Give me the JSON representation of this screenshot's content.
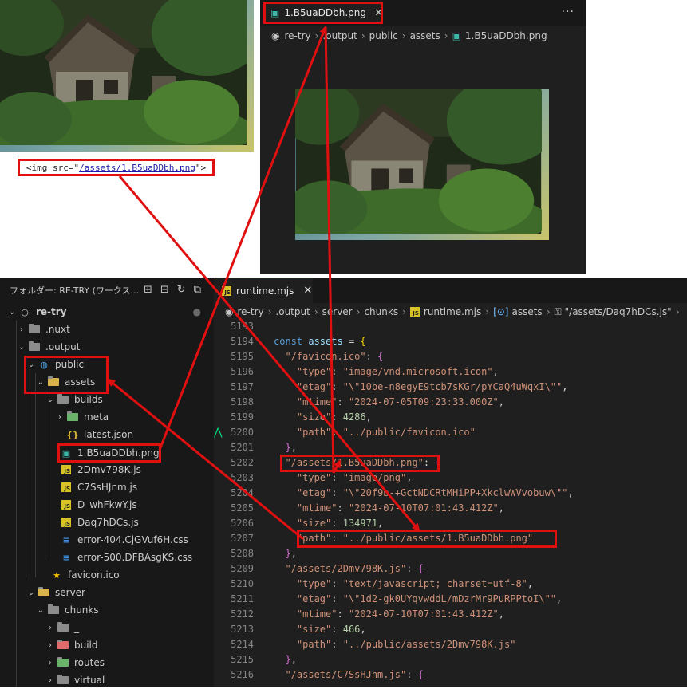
{
  "browser": {
    "img_tag_prefix": "<img src=\"",
    "img_tag_src": "/assets/1.B5uaDDbh.png",
    "img_tag_suffix": "\">"
  },
  "preview": {
    "tab_label": "1.B5uaDDbh.png",
    "more_label": "···",
    "breadcrumbs": [
      "re-try",
      ".output",
      "public",
      "assets",
      "1.B5uaDDbh.png"
    ]
  },
  "explorer": {
    "title": "フォルダー: RE-TRY (ワークス...",
    "items": [
      {
        "label": "re-try"
      },
      {
        "label": ".nuxt"
      },
      {
        "label": ".output"
      },
      {
        "label": "public"
      },
      {
        "label": "assets"
      },
      {
        "label": "builds"
      },
      {
        "label": "meta"
      },
      {
        "label": "latest.json"
      },
      {
        "label": "1.B5uaDDbh.png"
      },
      {
        "label": "2Dmv798K.js"
      },
      {
        "label": "C7SsHJnm.js"
      },
      {
        "label": "D_whFkwY.js"
      },
      {
        "label": "Daq7hDCs.js"
      },
      {
        "label": "error-404.CjGVuf6H.css"
      },
      {
        "label": "error-500.DFBAsgKS.css"
      },
      {
        "label": "favicon.ico"
      },
      {
        "label": "server"
      },
      {
        "label": "chunks"
      },
      {
        "label": "_"
      },
      {
        "label": "build"
      },
      {
        "label": "routes"
      },
      {
        "label": "virtual"
      }
    ]
  },
  "editor": {
    "tab_label": "runtime.mjs",
    "breadcrumbs": [
      "re-try",
      ".output",
      "server",
      "chunks",
      "runtime.mjs",
      "assets",
      "\"/assets/Daq7hDCs.js\"",
      "›"
    ],
    "line_numbers": [
      "5193",
      "5194",
      "5195",
      "5196",
      "5197",
      "5198",
      "5199",
      "5200",
      "5201",
      "5202",
      "5203",
      "5204",
      "5205",
      "5206",
      "5207",
      "5208",
      "5209",
      "5210",
      "5211",
      "5212",
      "5213",
      "5214",
      "5215",
      "5216"
    ],
    "lines": {
      "l5194_kw": "const",
      "l5194_name": "assets",
      "l5195_key": "\"/favicon.ico\"",
      "l5196_val": "\"image/vnd.microsoft.icon\"",
      "l5197_val": "\"\\\"10be-n8egyE9tcb7sKGr/pYCaQ4uWqxI\\\"\"",
      "l5198_val": "\"2024-07-05T09:23:33.000Z\"",
      "l5199_val": "4286",
      "l5200_val": "\"../public/favicon.ico\"",
      "l5202_key": "\"/assets/1.B5uaDDbh.png\"",
      "l5203_val": "\"image/png\"",
      "l5204_val": "\"\\\"20f9b-+GctNDCRtMHiPP+XkclwWVvobuw\\\"\"",
      "l5205_val": "\"2024-07-10T07:01:43.412Z\"",
      "l5206_val": "134971",
      "l5207_val": "\"../public/assets/1.B5uaDDbh.png\"",
      "l5209_key": "\"/assets/2Dmv798K.js\"",
      "l5210_val": "\"text/javascript; charset=utf-8\"",
      "l5211_val": "\"\\\"1d2-gk0UYqvwddL/mDzrMr9PuRPPtoI\\\"\"",
      "l5212_val": "\"2024-07-10T07:01:43.412Z\"",
      "l5213_val": "466",
      "l5214_val": "\"../public/assets/2Dmv798K.js\"",
      "l5216_key": "\"/assets/C7SsHJnm.js\"",
      "k_type": "\"type\"",
      "k_etag": "\"etag\"",
      "k_mtime": "\"mtime\"",
      "k_size": "\"size\"",
      "k_path": "\"path\""
    }
  },
  "colors": {
    "highlight": "#e01010",
    "editor_bg": "#1f1f1f",
    "sidebar_bg": "#181818"
  }
}
